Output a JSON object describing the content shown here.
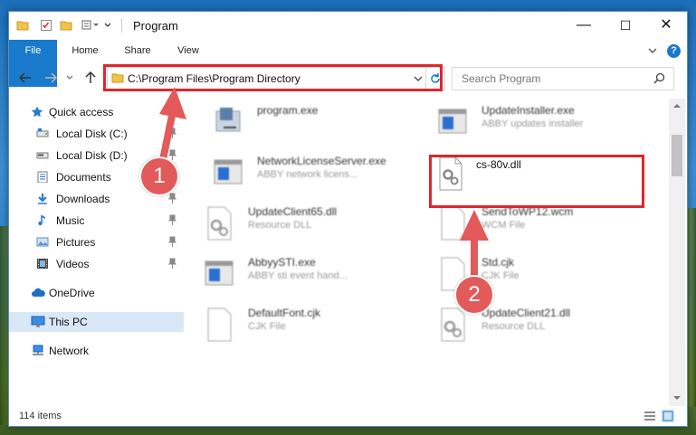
{
  "window": {
    "title": "Program",
    "minimize": "—",
    "maximize": "☐",
    "close": "✕"
  },
  "ribbon": {
    "tabs": [
      "File",
      "Home",
      "Share",
      "View"
    ],
    "help": "?"
  },
  "address": {
    "path": "C:\\Program Files\\Program Directory",
    "placeholder": "Search Program"
  },
  "nav": {
    "items": [
      {
        "label": "Quick access",
        "icon": "star-icon"
      },
      {
        "label": "Local Disk (C:)",
        "icon": "drive-icon"
      },
      {
        "label": "Local Disk (D:)",
        "icon": "drive-icon"
      },
      {
        "label": "Documents",
        "icon": "documents-icon"
      },
      {
        "label": "Downloads",
        "icon": "download-arrow-icon"
      },
      {
        "label": "Music",
        "icon": "music-note-icon"
      },
      {
        "label": "Pictures",
        "icon": "pictures-icon"
      },
      {
        "label": "Videos",
        "icon": "film-icon"
      },
      {
        "label": "OneDrive",
        "icon": "cloud-icon"
      },
      {
        "label": "This PC",
        "icon": "monitor-icon"
      },
      {
        "label": "Network",
        "icon": "network-icon"
      }
    ]
  },
  "files": [
    {
      "name": "program.exe",
      "sub": ""
    },
    {
      "name": "UpdateInstaller.exe",
      "sub": "ABBY updates installer"
    },
    {
      "name": "NetworkLicenseServer.exe",
      "sub": "ABBY network licens..."
    },
    {
      "name": "cs-80v.dll",
      "sub": ""
    },
    {
      "name": "UpdateClient65.dll",
      "sub": "Resource DLL"
    },
    {
      "name": "SendToWP12.wcm",
      "sub": "WCM File"
    },
    {
      "name": "AbbyySTI.exe",
      "sub": "ABBY sti event hand..."
    },
    {
      "name": "Std.cjk",
      "sub": "CJK File"
    },
    {
      "name": "DefaultFont.cjk",
      "sub": "CJK File"
    },
    {
      "name": "UpdateClient21.dll",
      "sub": "Resource DLL"
    }
  ],
  "status": {
    "items": "114 items"
  },
  "annotations": {
    "step1": "1",
    "step2": "2"
  },
  "colors": {
    "highlight": "#e0262b",
    "badge": "#e35a5a",
    "file_tab": "#1979ca"
  }
}
